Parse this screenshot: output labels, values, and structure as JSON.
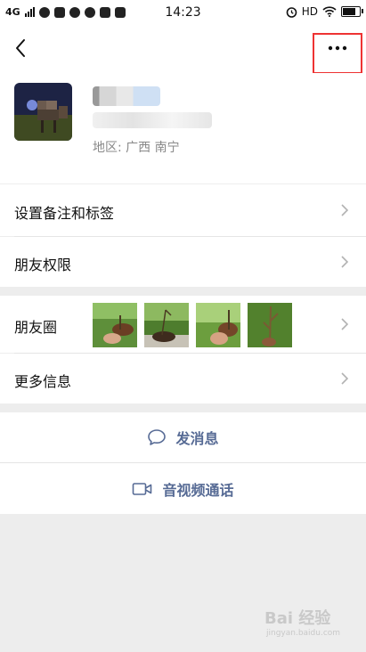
{
  "status_bar": {
    "network": "4G",
    "time": "14:23",
    "hd_label": "HD",
    "battery_level": 0.85
  },
  "nav": {
    "back_icon": "chevron-left-icon",
    "more_icon": "ellipsis-icon"
  },
  "profile": {
    "region_label": "地区:",
    "region_province": "广西",
    "region_city": "南宁"
  },
  "menu": {
    "remark_tags": "设置备注和标签",
    "friend_permissions": "朋友权限",
    "moments": "朋友圈",
    "more_info": "更多信息"
  },
  "actions": {
    "send_message": "发消息",
    "video_call": "音视频通话"
  },
  "watermark": {
    "brand": "Bai 经验",
    "url": "jingyan.baidu.com"
  },
  "colors": {
    "link_blue": "#576b95",
    "highlight_red": "#e33333",
    "page_bg": "#ededed"
  }
}
